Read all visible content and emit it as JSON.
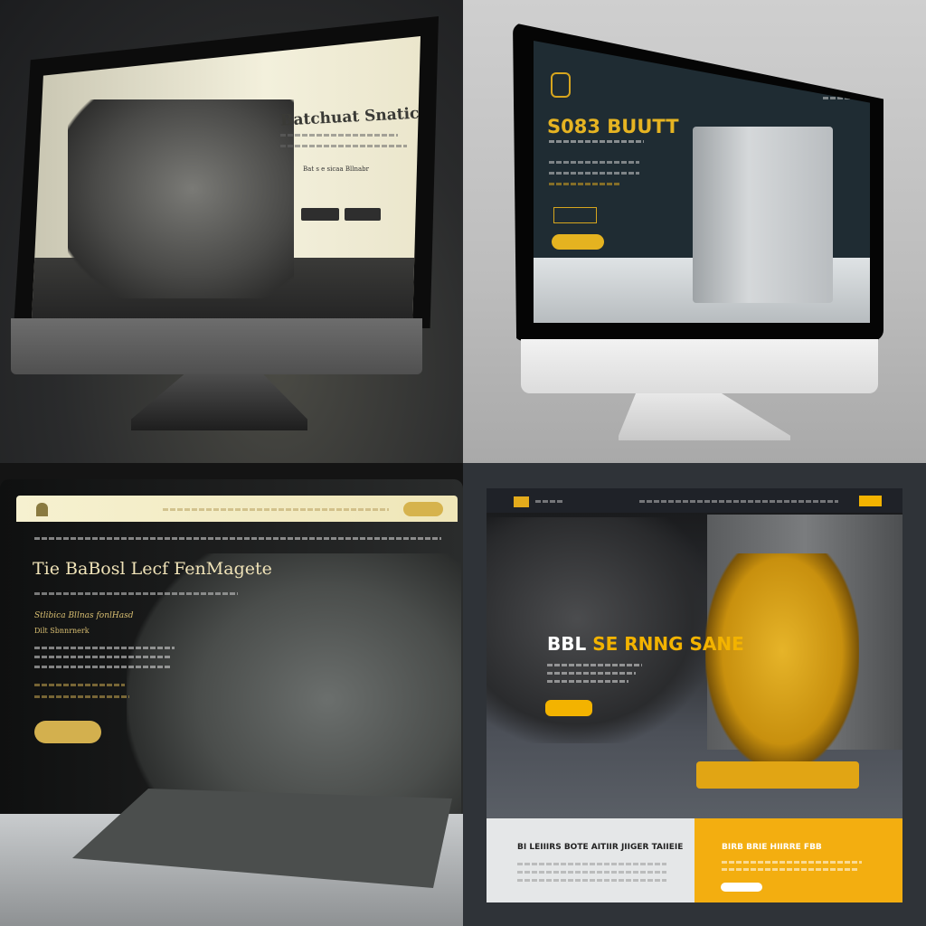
{
  "panels": [
    {
      "headline": "Batchuat Snatichdusri",
      "subheading": "Bat s e sicaa Bllnabr"
    },
    {
      "headline": "S083 BUUTT"
    },
    {
      "headline": "Tie BaBosl Lecf FenMagete",
      "subheading": "Stlibica Bllnas fonlHasd",
      "subheading2": "Dilt Sbnnrnerk"
    },
    {
      "headline_white": "BBL",
      "headline_yellow": "SE RNNG SANE",
      "panel_left_heading": "BI LEIIIRS BOTE AITIIR JIIGER TAIIEIE",
      "panel_right_heading": "BIRB BRIE HIIRRE FBB"
    }
  ],
  "colors": {
    "gold": "#d6b34d",
    "yellow": "#f3b300",
    "slate": "#1f2c33",
    "cream": "#f3f0dc"
  }
}
